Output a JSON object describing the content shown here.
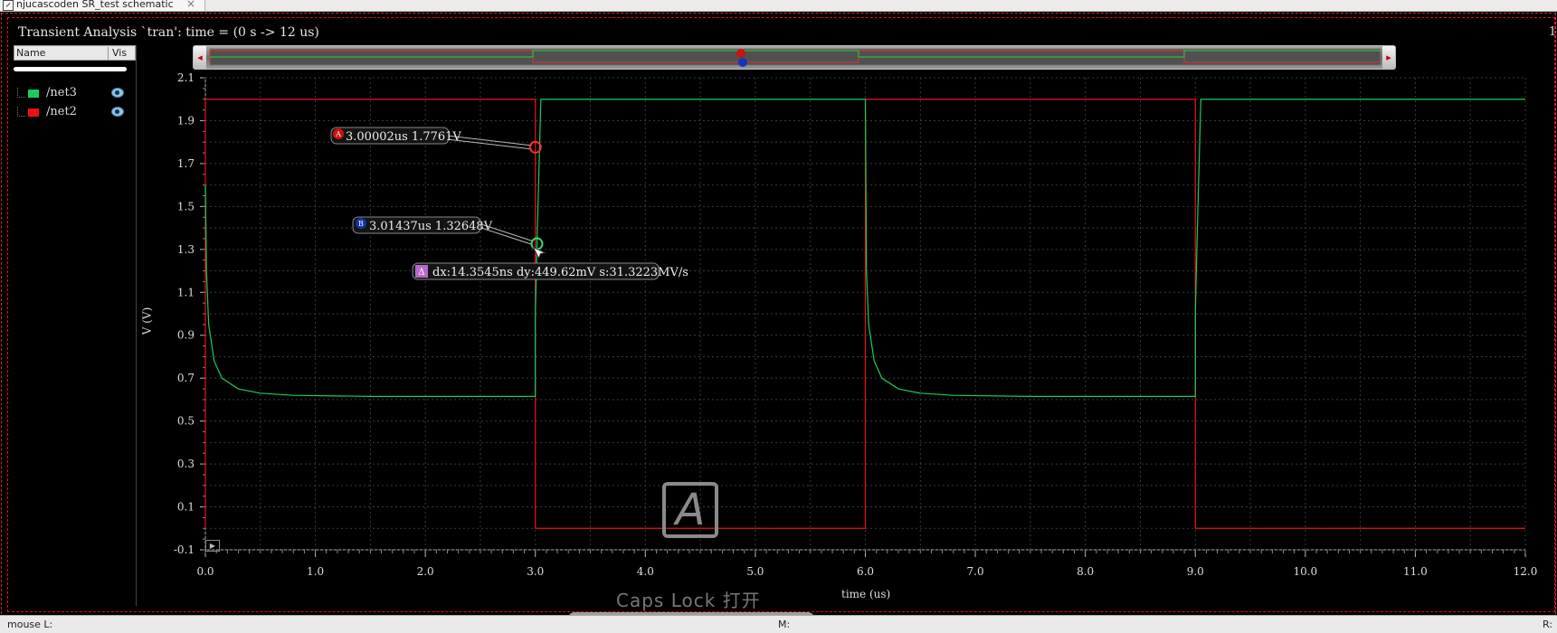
{
  "tab": {
    "title": "njucascoden SR_test schematic",
    "close": "×"
  },
  "analysis_title": "Transient Analysis `tran': time = (0 s -> 12 us)",
  "right_marker": "1",
  "legend": {
    "header_name": "Name",
    "header_vis": "Vis",
    "items": [
      {
        "label": "/net3",
        "color": "#19cc5a"
      },
      {
        "label": "/net2",
        "color": "#ee1111"
      }
    ]
  },
  "axes": {
    "ylabel": "V (V)",
    "xlabel": "time (us)"
  },
  "markers": {
    "A": {
      "letter": "A",
      "label": "3.00002us 1.7761V"
    },
    "B": {
      "letter": "B",
      "label": "3.01437us 1.32648V"
    },
    "delta": {
      "label": "dx:14.3545ns dy:449.62mV s:31.3223MV/s"
    }
  },
  "watermark": "A",
  "caps_lock": "Caps  Lock  打开",
  "status": {
    "mouse_l": "mouse L:",
    "mouse_m": "M:",
    "mouse_r": "R:"
  },
  "chart_data": {
    "type": "line",
    "xlabel": "time (us)",
    "ylabel": "V (V)",
    "xlim": [
      0,
      12
    ],
    "ylim": [
      -0.1,
      2.1
    ],
    "x_ticks": [
      "0.0",
      "1.0",
      "2.0",
      "3.0",
      "4.0",
      "5.0",
      "6.0",
      "7.0",
      "8.0",
      "9.0",
      "10.0",
      "11.0",
      "12.0"
    ],
    "y_ticks": [
      "2.1",
      "1.9",
      "1.7",
      "1.5",
      "1.3",
      "1.1",
      "0.9",
      "0.7",
      "0.5",
      "0.3",
      "0.1",
      "-0.1"
    ],
    "grid": true,
    "series": [
      {
        "name": "/net2",
        "color": "#ee1111",
        "x": [
          0,
          0,
          3.0,
          3.0,
          6.0,
          6.0,
          9.0,
          9.0,
          12.0
        ],
        "y": [
          0.0,
          2.0,
          2.0,
          0.0,
          0.0,
          2.0,
          2.0,
          0.0,
          0.0
        ]
      },
      {
        "name": "/net3",
        "color": "#19cc5a",
        "x": [
          0,
          0.01,
          0.03,
          0.08,
          0.15,
          0.3,
          0.5,
          0.8,
          1.5,
          3.0,
          3.0,
          3.015,
          3.05,
          6.0,
          6.01,
          6.03,
          6.08,
          6.15,
          6.3,
          6.5,
          6.8,
          7.5,
          9.0,
          9.0,
          9.015,
          9.05,
          12.0
        ],
        "y": [
          1.6,
          1.2,
          0.95,
          0.78,
          0.7,
          0.65,
          0.63,
          0.62,
          0.615,
          0.615,
          1.0,
          1.33,
          2.0,
          2.0,
          1.2,
          0.95,
          0.78,
          0.7,
          0.65,
          0.63,
          0.62,
          0.615,
          0.615,
          1.0,
          1.33,
          2.0,
          2.0
        ]
      }
    ]
  }
}
